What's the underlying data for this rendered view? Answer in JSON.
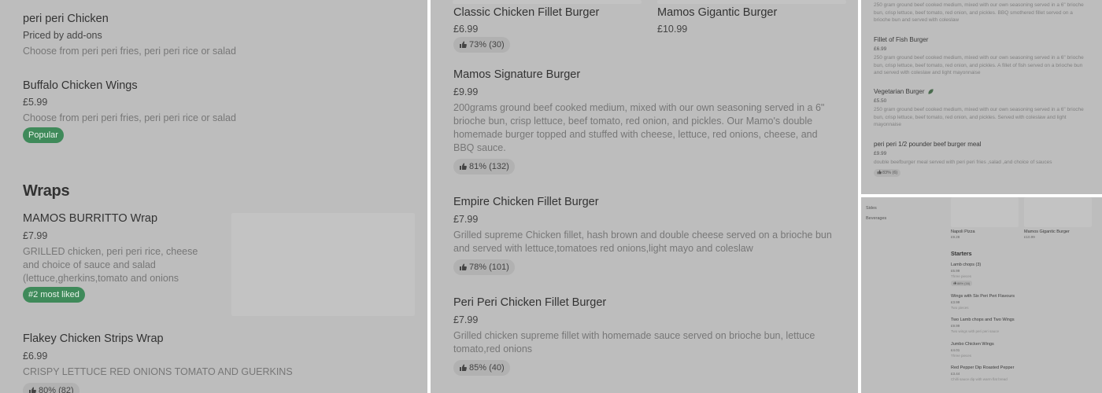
{
  "panel1": {
    "items_top": [
      {
        "name": "peri peri Chicken",
        "price": "Priced by add-ons",
        "desc": "Choose from peri peri fries, peri peri rice or salad"
      },
      {
        "name": "Buffalo Chicken Wings",
        "price": "£5.99",
        "desc": "Choose from peri peri fries, peri peri rice or salad",
        "badge": "Popular"
      }
    ],
    "section_title": "Wraps",
    "wraps": [
      {
        "name": "MAMOS BURRITTO Wrap",
        "price": "£7.99",
        "desc": "GRILLED chicken, peri peri rice, cheese and choice of sauce and salad (lettuce,gherkins,tomato and onions",
        "badge": "#2 most liked"
      },
      {
        "name": "Flakey Chicken Strips Wrap",
        "price": "£6.99",
        "desc": "CRISPY LETTUCE RED ONIONS TOMATO AND GUERKINS",
        "rating": "80% (82)"
      }
    ]
  },
  "panel2": {
    "top_items": [
      {
        "name": "Classic Chicken Fillet Burger",
        "price": "£6.99",
        "rating": "73% (30)"
      },
      {
        "name": "Mamos Gigantic Burger",
        "price": "£10.99"
      }
    ],
    "items": [
      {
        "name": "Mamos Signature Burger",
        "price": "£9.99",
        "desc": "200grams ground beef cooked medium, mixed with our own seasoning served in a 6\" brioche bun, crisp lettuce, beef tomato, red onion, and pickles. Our Mamo's double homemade burger topped and stuffed with cheese, lettuce, red onions, cheese, and BBQ sauce.",
        "rating": "81% (132)"
      },
      {
        "name": "Empire Chicken Fillet Burger",
        "price": "£7.99",
        "desc": "Grilled supreme Chicken fillet, hash brown and double cheese served on a brioche bun and served with lettuce,tomatoes red onions,light mayo and coleslaw",
        "rating": "78% (101)"
      },
      {
        "name": "Peri Peri Chicken Fillet Burger",
        "price": "£7.99",
        "desc": "Grilled chicken supreme fillet with homemade sauce served on brioche bun, lettuce tomato,red onions",
        "rating": "85% (40)"
      }
    ]
  },
  "panel3": {
    "top_desc": "250 gram ground beef cooked medium, mixed with our own seasoning served in a 6\" brioche bun, crisp lettuce, beef tomato, red onion, and pickles. BBQ smothered fillet served on a brioche bun and served with coleslaw",
    "items": [
      {
        "name": "Fillet of Fish Burger",
        "price": "£6.99",
        "desc": "250 gram ground beef cooked medium, mixed with our own seasoning served in a 6\" brioche bun, crisp lettuce, beef tomato, red onion, and pickles. A fillet of fish served on a brioche bun and served with coleslaw and light mayonnaise"
      },
      {
        "name": "Vegetarian Burger",
        "price": "£5.50",
        "desc": "250 gram ground beef cooked medium, mixed with our own seasoning served in a 6\" brioche bun, crisp lettuce, beef tomato, red onion, and pickles. Served with coleslaw and light mayonnaise",
        "icon": "leaf-icon"
      },
      {
        "name": "peri peri 1/2 pounder beef burger meal",
        "price": "£9.99",
        "desc": "double beefburger meal served with peri peri fries ,salad ,and choice of sauces",
        "rating": "83% (6)"
      }
    ]
  },
  "panel4": {
    "sidebar": [
      "Sides",
      "Beverages"
    ],
    "featured": [
      {
        "name": "Napoli Pizza",
        "price": "£9.28"
      },
      {
        "name": "Mamos Gigantic Burger",
        "price": "£10.99"
      }
    ],
    "section_title": "Starters",
    "items": [
      {
        "name": "Lamb chops (3)",
        "price": "£6.99",
        "desc": "Three pieces",
        "rating": "88% (16)"
      },
      {
        "name": "Wings with Six Peri Peri Flavours",
        "price": "£3.99",
        "desc": "Two pieces"
      },
      {
        "name": "Two Lamb chops and Two Wings",
        "price": "£9.99",
        "desc": "Two wings with peri peri sauce"
      },
      {
        "name": "Jumbo Chicken Wings",
        "price": "£4.01",
        "desc": "Three pieces"
      },
      {
        "name": "Red Pepper Dip Roasted Pepper",
        "price": "£3.44",
        "desc": "Chilli sauce dip with warm flat bread"
      }
    ]
  }
}
